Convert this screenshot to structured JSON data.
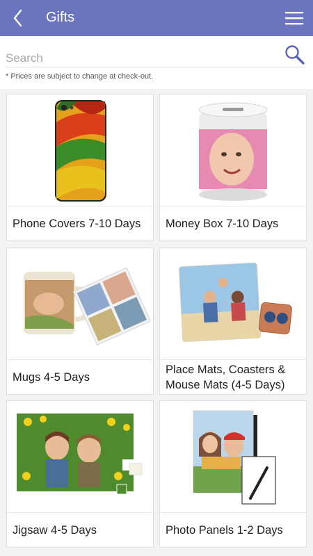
{
  "header": {
    "title": "Gifts"
  },
  "search": {
    "placeholder": "Search"
  },
  "note": "* Prices are subject to change at check-out.",
  "products": [
    {
      "label": "Phone Covers 7-10 Days"
    },
    {
      "label": "Money Box 7-10 Days"
    },
    {
      "label": "Mugs 4-5 Days"
    },
    {
      "label": "Place Mats, Coasters & Mouse Mats (4-5 Days)"
    },
    {
      "label": "Jigsaw 4-5 Days"
    },
    {
      "label": "Photo Panels 1-2 Days"
    }
  ],
  "colors": {
    "appbar": "#6b74bf",
    "background": "#f3f3f3",
    "accent": "#5a64b8"
  }
}
